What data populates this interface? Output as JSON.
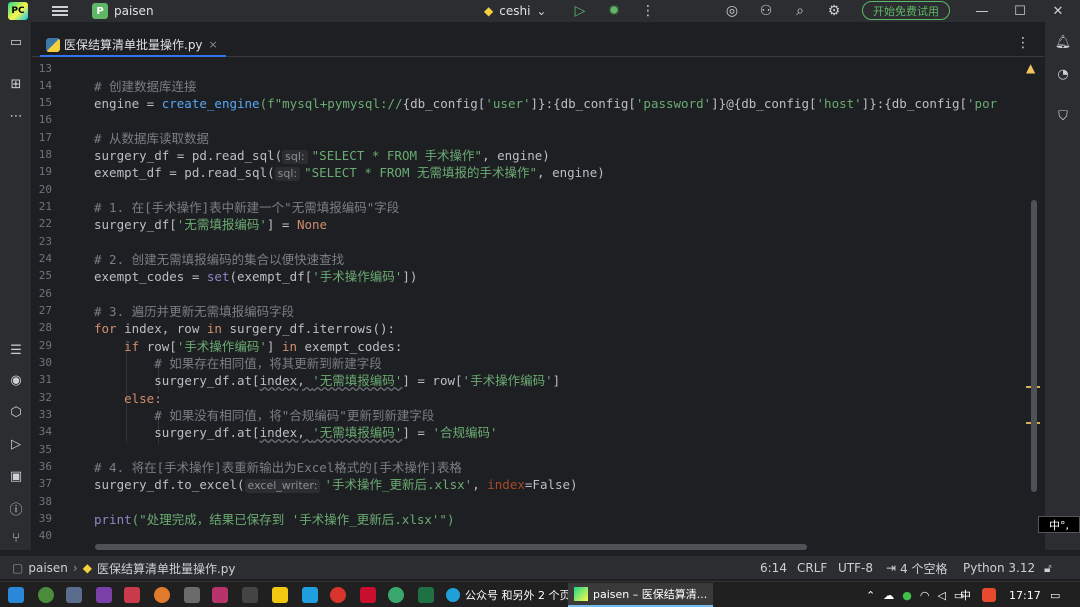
{
  "titlebar": {
    "project_badge": "P",
    "project_name": "paisen",
    "run_config": "ceshi",
    "trial_button": "开始免费试用",
    "icons": [
      "hamburger-menu-icon",
      "python-icon",
      "chevron-down-icon",
      "run-icon",
      "debug-icon",
      "more-vertical-icon",
      "ai-assistant-icon",
      "add-user-icon",
      "search-icon",
      "settings-gear-icon",
      "minimize-icon",
      "maximize-icon",
      "close-icon"
    ]
  },
  "left_toolbar": {
    "icons": [
      "project-folder-icon",
      "structure-icon",
      "more-horizontal-icon",
      "todo-list-icon",
      "python-packages-icon",
      "services-icon",
      "run-icon",
      "terminal-icon",
      "problems-icon",
      "git-icon"
    ]
  },
  "right_toolbar": {
    "icons": [
      "notifications-bell-icon",
      "ai-chat-icon",
      "security-shield-icon"
    ]
  },
  "tab": {
    "label": "医保结算清单批量操作.py",
    "close": "×"
  },
  "editor": {
    "line_numbers": [
      "13",
      "14",
      "15",
      "16",
      "17",
      "18",
      "19",
      "20",
      "21",
      "22",
      "23",
      "24",
      "25",
      "26",
      "27",
      "28",
      "29",
      "30",
      "31",
      "32",
      "33",
      "34",
      "35",
      "36",
      "37",
      "38",
      "39",
      "40"
    ],
    "comments": {
      "c14": "# 创建数据库连接",
      "c17": "# 从数据库读取数据",
      "c21": "# 1. 在[手术操作]表中新建一个\"无需填报编码\"字段",
      "c24": "# 2. 创建无需填报编码的集合以便快速查找",
      "c27": "# 3. 遍历并更新无需填报编码字段",
      "c30": "# 如果存在相同值，将其更新到新建字段",
      "c33": "# 如果没有相同值，将\"合规编码\"更新到新建字段",
      "c36": "# 4. 将在[手术操作]表重新输出为Excel格式的[手术操作]表格"
    },
    "hints": {
      "sql1": "sql:",
      "sql2": "sql:",
      "excel_writer": "excel_writer:"
    },
    "tokens": {
      "engine_assign": "engine = ",
      "create_engine": "create_engine",
      "fstr": "(f\"mysql+pymysql://",
      "cfg1": "{db_config[",
      "user": "'user'",
      "cfg2": "]}:{db_config[",
      "password": "'password'",
      "cfg3": "]}@{db_config[",
      "host": "'host'",
      "cfg4": "]}:{db_config[",
      "por": "'por",
      "surgery_assign": "surgery_df = pd.read_sql(",
      "sql_surgery": "\"SELECT * FROM 手术操作\"",
      "engine_close": ", engine)",
      "exempt_assign": "exempt_df = pd.read_sql(",
      "sql_exempt": "\"SELECT * FROM 无需填报的手术操作\"",
      "surgery_df_open": "surgery_df[",
      "col_nofill": "'无需填报编码'",
      "eq_none": "] = ",
      "none": "None",
      "exempt_codes_assign": "exempt_codes = ",
      "set": "set",
      "exempt_df_open": "(exempt_df[",
      "col_op": "'手术操作编码'",
      "close2": "])",
      "for": "for",
      "for_vars": " index, row ",
      "in": "in",
      "iterrows": " surgery_df.iterrows():",
      "if": "if",
      "row_open": " row[",
      "in_close": "] ",
      "exempt_codes_colon": " exempt_codes:",
      "at_open": "surgery_df.at[",
      "index_comma": "index, ",
      "eq_row": "] = row[",
      "bracket": "]",
      "else": "else:",
      "eq": "] = ",
      "compliant": "'合规编码'",
      "to_excel": "surgery_df.to_excel(",
      "excel_name": "'手术操作_更新后.xlsx'",
      "comma": ", ",
      "index_kw": "index",
      "false": "=False)",
      "print": "print",
      "print_str": "(\"处理完成，结果已保存到 '手术操作_更新后.xlsx'\")"
    }
  },
  "statusbar": {
    "project": "paisen",
    "file": "医保结算清单批量操作.py",
    "position": "6:14",
    "line_sep": "CRLF",
    "encoding": "UTF-8",
    "indent": "4 个空格",
    "interpreter": "Python 3.12"
  },
  "ime": "中°,",
  "taskbar": {
    "app1": "公众号 和另外 2 个页...",
    "app2": "paisen – 医保结算清...",
    "tray_lang": "中",
    "time": "17:17"
  }
}
